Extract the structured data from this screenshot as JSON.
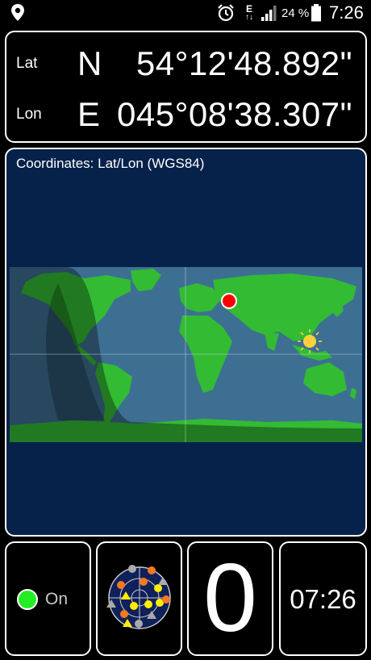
{
  "status_bar": {
    "battery_percent": "24 %",
    "network_type": "E",
    "time": "7:26",
    "icons": [
      "location-pin-icon",
      "alarm-icon",
      "network-icon",
      "signal-icon",
      "battery-icon"
    ]
  },
  "coordinates": {
    "lat_label": "Lat",
    "lat_hemisphere": "N",
    "lat_value": "54°12'48.892\"",
    "lon_label": "Lon",
    "lon_hemisphere": "E",
    "lon_value": "045°08'38.307\""
  },
  "map": {
    "title": "Coordinates: Lat/Lon (WGS84)",
    "marker_lat": 54.21,
    "marker_lon": 45.14,
    "sun_icon": "sun-icon",
    "colors": {
      "ocean": "#3d6f93",
      "land": "#33bb33",
      "panel": "#06224a",
      "marker": "#ff0000"
    }
  },
  "gps": {
    "status_label": "On",
    "status_color": "#22ee22",
    "satellite_count": "0",
    "clock": "07:26",
    "sky_icon": "satellite-skyplot-icon"
  }
}
